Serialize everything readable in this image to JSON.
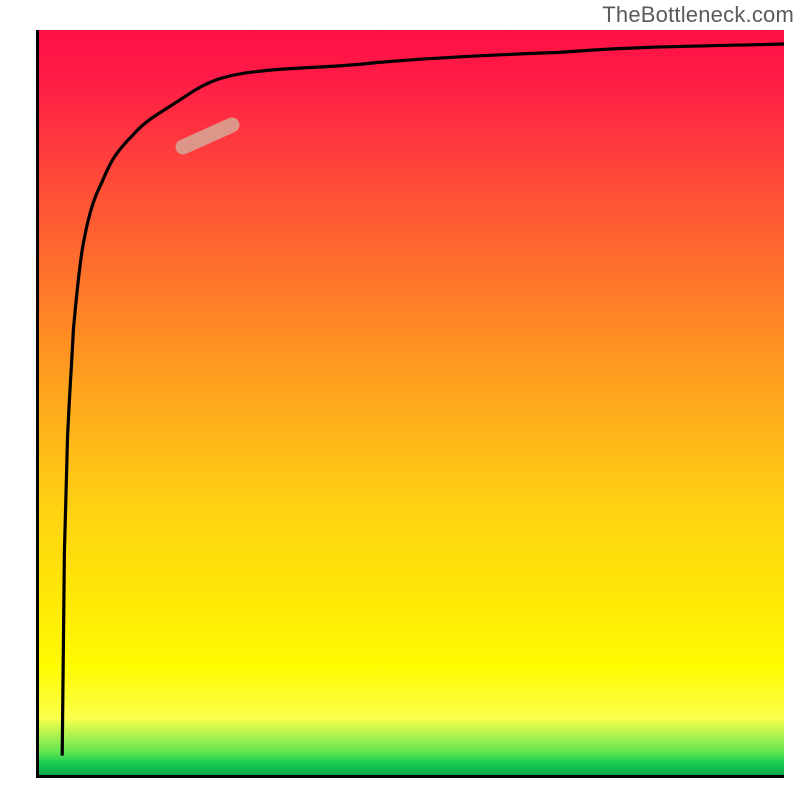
{
  "watermark": "TheBottleneck.com",
  "chart_data": {
    "type": "line",
    "title": "",
    "xlabel": "",
    "ylabel": "",
    "xlim": [
      0,
      100
    ],
    "ylim": [
      0,
      100
    ],
    "grid": false,
    "legend": false,
    "gradient_colors_top_to_bottom": [
      "#ff1144",
      "#ff6a2e",
      "#ffd212",
      "#fffb00",
      "#18cc52"
    ],
    "series": [
      {
        "name": "curve",
        "color": "#000000",
        "x": [
          3.5,
          3.6,
          3.8,
          4.2,
          5.0,
          6.0,
          8.0,
          10.0,
          13.0,
          16.0,
          20.0,
          25.0,
          30.0,
          40.0,
          55.0,
          70.0,
          85.0,
          100.0
        ],
        "y": [
          3.0,
          15.0,
          30.0,
          45.0,
          60.0,
          70.0,
          78.0,
          82.5,
          86.0,
          88.5,
          90.5,
          92.0,
          93.0,
          94.5,
          95.5,
          96.2,
          96.6,
          97.0
        ]
      }
    ],
    "marker": {
      "name": "highlight-segment",
      "x_range": [
        19.5,
        26.5
      ],
      "y_range": [
        84.0,
        87.5
      ],
      "color": "#d89a8c",
      "stroke_width": 14
    },
    "axes_color": "#000000",
    "axes_stroke_width": 6
  }
}
